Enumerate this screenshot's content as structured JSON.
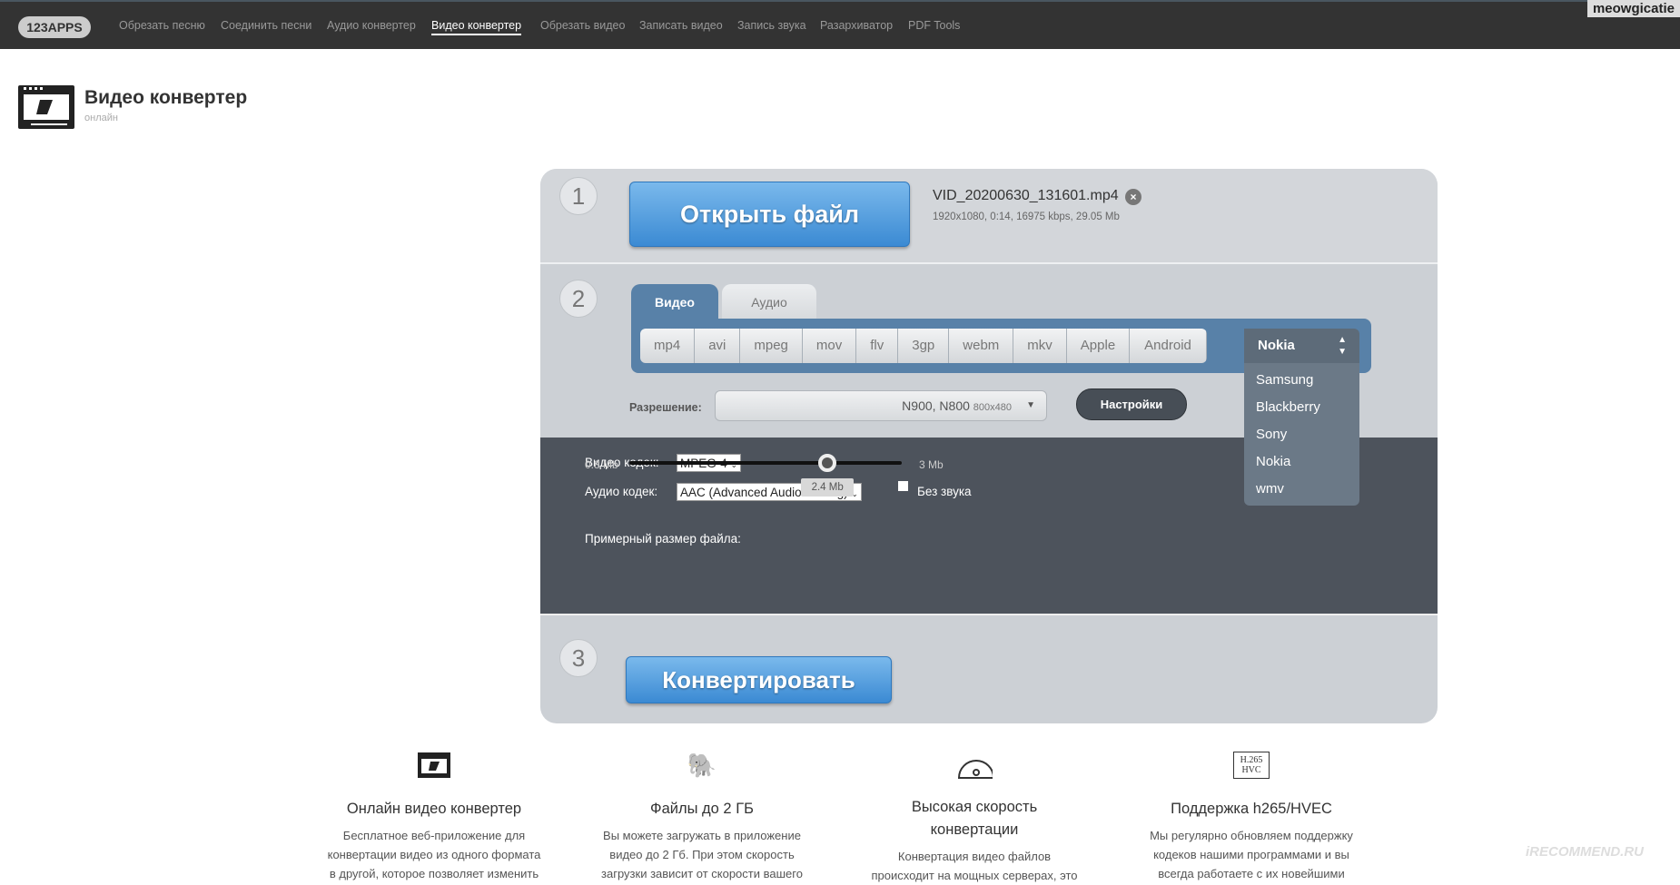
{
  "nav": {
    "logo": "123APPS",
    "items": [
      "Обрезать песню",
      "Соединить песни",
      "Аудио конвертер",
      "Видео конвертер",
      "Обрезать видео",
      "Записать видео",
      "Запись звука",
      "Разархиватор",
      "PDF Tools"
    ],
    "active": "Видео конвертер"
  },
  "watermark": "meowgicatie",
  "header": {
    "title": "Видео конвертер",
    "subtitle": "онлайн"
  },
  "step1": {
    "number": "1",
    "open_button": "Открыть файл",
    "file_name": "VID_20200630_131601.mp4",
    "file_meta": "1920x1080, 0:14, 16975 kbps, 29.05 Mb"
  },
  "step2": {
    "number": "2",
    "tabs": [
      "Видео",
      "Аудио"
    ],
    "active_tab": "Видео",
    "formats": [
      "mp4",
      "avi",
      "mpeg",
      "mov",
      "flv",
      "3gp",
      "webm",
      "mkv",
      "Apple",
      "Android"
    ],
    "selected_device": "Nokia",
    "dropdown": [
      "Samsung",
      "Blackberry",
      "Sony",
      "Nokia",
      "wmv"
    ],
    "resolution_label": "Разрешение:",
    "resolution_value": "N900, N800",
    "resolution_size": "800x480",
    "settings_button": "Настройки",
    "video_codec_label": "Видео кодек:",
    "video_codec": "MPEG-4",
    "audio_codec_label": "Аудио кодек:",
    "audio_codec": "AAC (Advanced Audio Coding)",
    "mute_label": "Без звука",
    "mute_checked": false,
    "size_label": "Примерный размер файла:",
    "size_min": "0.8 Mb",
    "size_max": "3 Mb",
    "size_value": "2.4 Mb",
    "size_numeric": 2.4
  },
  "step3": {
    "number": "3",
    "convert_button": "Конвертировать"
  },
  "features": [
    {
      "icon": "film-icon",
      "title": "Онлайн видео конвертер",
      "lines": [
        "Бесплатное веб-приложение для",
        "конвертации видео из одного формата",
        "в другой, которое позволяет изменить"
      ]
    },
    {
      "icon": "elephant-icon",
      "title": "Файлы до 2 ГБ",
      "lines": [
        "Вы можете загружать в приложение",
        "видео до 2 Гб. При этом скорость",
        "загрузки зависит от скорости вашего"
      ]
    },
    {
      "icon": "speedometer-icon",
      "title": "Высокая скорость конвертации",
      "lines": [
        "Конвертация видео файлов",
        "происходит на мощных серверах, это"
      ]
    },
    {
      "icon": "h265-icon",
      "icon_text": "H.265 HVC",
      "title": "Поддержка h265/HVEC",
      "lines": [
        "Мы регулярно обновляем поддержку",
        "кодеков нашими программами и вы",
        "всегда работаете с их новейшими"
      ]
    }
  ],
  "recommend_watermark": "iRECOMMEND.RU"
}
